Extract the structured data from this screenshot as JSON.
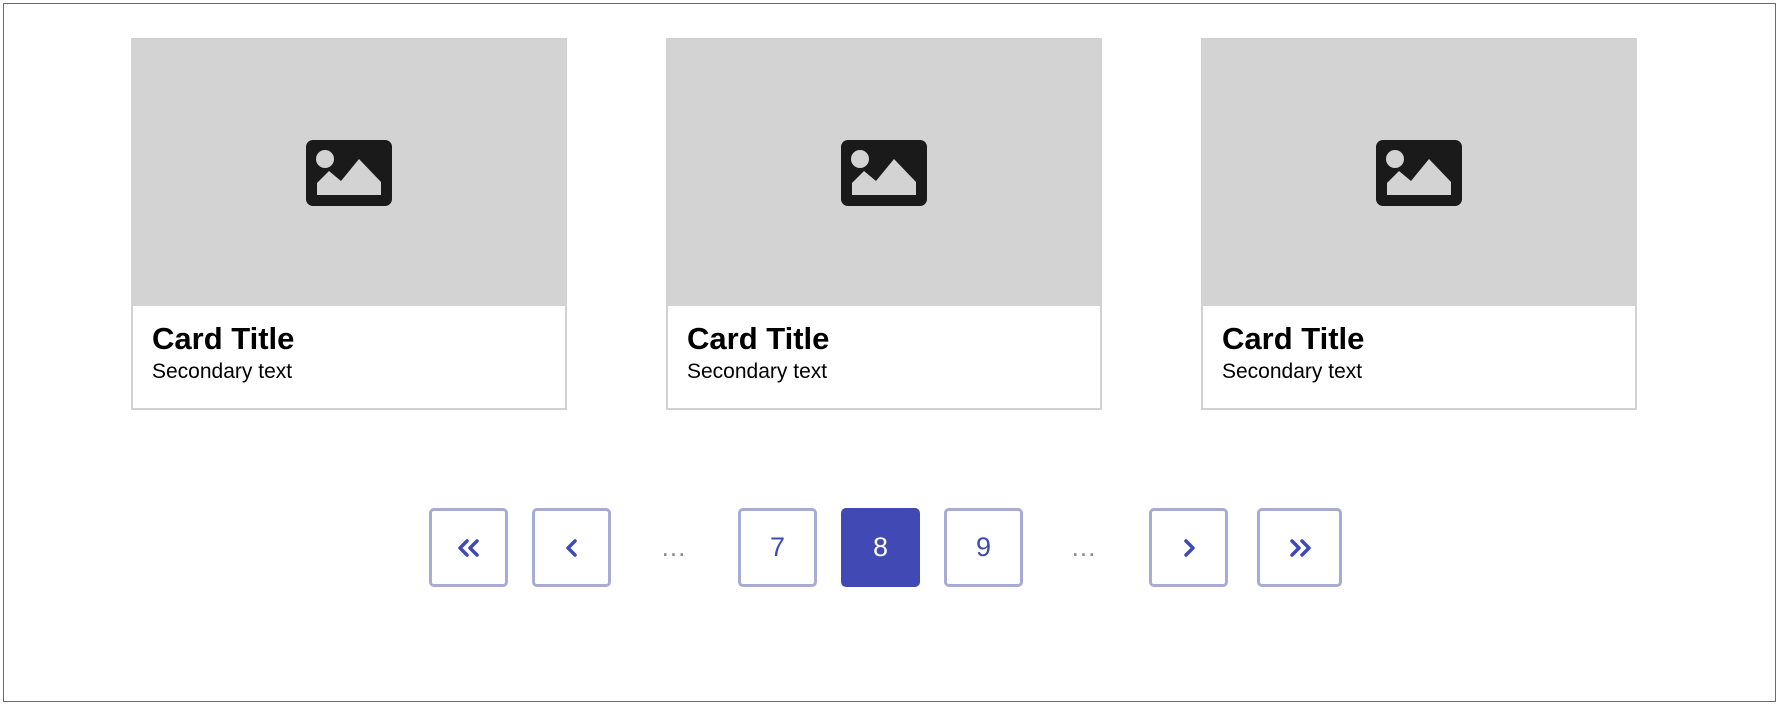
{
  "cards": [
    {
      "title": "Card Title",
      "subtitle": "Secondary text",
      "media_icon": "image-icon"
    },
    {
      "title": "Card Title",
      "subtitle": "Secondary text",
      "media_icon": "image-icon"
    },
    {
      "title": "Card Title",
      "subtitle": "Secondary text",
      "media_icon": "image-icon"
    }
  ],
  "pagination": {
    "first_icon": "double-chevron-left-icon",
    "prev_icon": "chevron-left-icon",
    "ellipsis_before": "...",
    "pages": [
      "7",
      "8",
      "9"
    ],
    "current_page": "8",
    "ellipsis_after": "...",
    "next_icon": "chevron-right-icon",
    "last_icon": "double-chevron-right-icon"
  },
  "colors": {
    "accent": "#4149b5",
    "button_border": "#a8abd4",
    "media_background": "#d3d3d3",
    "icon": "#1a1a1a"
  }
}
